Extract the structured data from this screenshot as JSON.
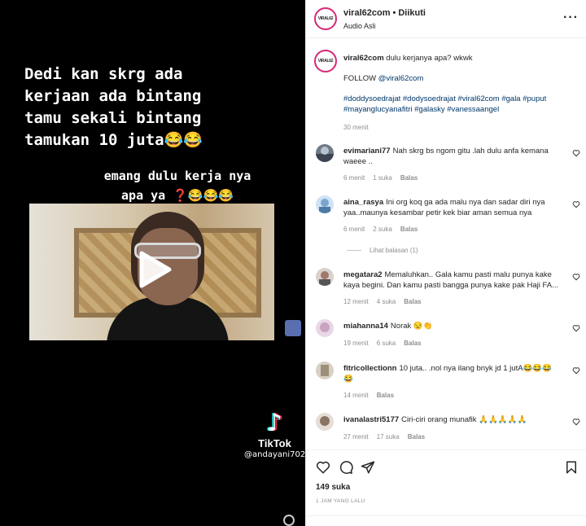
{
  "media": {
    "caption_lines": [
      "Dedi kan skrg ada",
      "kerjaan ada bintang",
      "tamu sekali bintang",
      "tamukan 10 juta😂😂"
    ],
    "subcaption_lines": [
      "emang dulu kerja nya",
      "apa ya ❓😂😂😂"
    ],
    "tiktok_brand": "TikTok",
    "tiktok_user": "@andayani702"
  },
  "post": {
    "username": "viral62com",
    "follow_state": "Diikuti",
    "audio": "Audio Asli",
    "avatar_text": "VIRAL62"
  },
  "caption": {
    "username": "viral62com",
    "text": "dulu kerjanya apa? wkwk",
    "follow_prefix": "FOLLOW ",
    "follow_handle": "@viral62com",
    "hashtags": "#doddysoedrajat #dodysoedrajat #viral62com #gala #puput #mayanglucyanafitri #galasky #vanessaangel",
    "time": "30 menit"
  },
  "comments": [
    {
      "user": "evimariani77",
      "text": "Nah skrg bs ngom gitu .lah dulu anfa kemana waeee ..",
      "time": "6 menit",
      "likes": "1 suka",
      "reply": "Balas"
    },
    {
      "user": "aina_rasya",
      "text": "Ini org koq ga ada malu nya dan sadar diri nya yaa..maunya kesambar petir kek biar aman semua nya",
      "time": "6 menit",
      "likes": "2 suka",
      "reply": "Balas",
      "view_replies": "Lihat balasan (1)"
    },
    {
      "user": "megatara2",
      "text": "Memaluhkan.. Gala kamu pasti malu punya kake kaya begini. Dan kamu pasti bangga punya kake pak Haji FA...",
      "time": "12 menit",
      "likes": "4 suka",
      "reply": "Balas"
    },
    {
      "user": "miahanna14",
      "text": "Norak 😒👏",
      "time": "19 menit",
      "likes": "6 suka",
      "reply": "Balas"
    },
    {
      "user": "fitricollectionn",
      "text": "10 juta.. .nol nya ilang bnyk jd 1 jutA😂😂😂😂",
      "time": "14 menit",
      "likes": "",
      "reply": "Balas"
    },
    {
      "user": "ivanalastri5177",
      "text": "Ciri-ciri orang munafik 🙏🙏🙏🙏🙏",
      "time": "27 menit",
      "likes": "17 suka",
      "reply": "Balas"
    }
  ],
  "footer": {
    "likes": "149 suka",
    "posted": "1 JAM YANG LALU"
  },
  "icons": [
    "more-icon",
    "heart-icon",
    "comment-icon",
    "share-icon",
    "bookmark-icon",
    "play-icon",
    "tiktok-icon"
  ],
  "colors": {
    "link": "#00376b",
    "muted": "#8e8e8e",
    "avatar_ring": "#d62976"
  }
}
